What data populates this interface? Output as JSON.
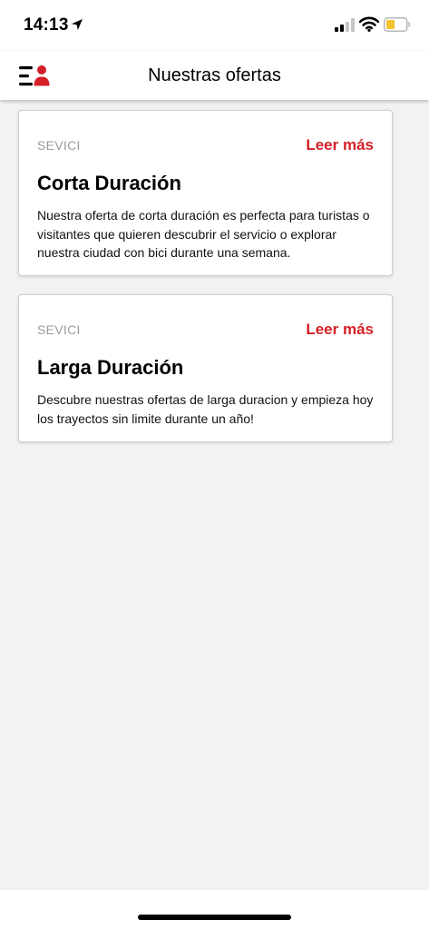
{
  "status_bar": {
    "time": "14:13",
    "icons": [
      "location-arrow-icon",
      "cellular-signal-icon",
      "wifi-icon",
      "battery-low-icon"
    ]
  },
  "header": {
    "title": "Nuestras ofertas",
    "menu_icon": "menu-profile-icon"
  },
  "offers": [
    {
      "category": "SEVICI",
      "link_label": "Leer más",
      "title": "Corta Duración",
      "description": "Nuestra oferta de corta duración es perfecta para turistas o visitantes que quieren descubrir el servicio o explorar nuestra ciudad con bici durante una semana."
    },
    {
      "category": "SEVICI",
      "link_label": "Leer más",
      "title": "Larga Duración",
      "description": "Descubre nuestras ofertas de larga duracion y empieza hoy los trayectos sin limite durante un año!"
    }
  ],
  "colors": {
    "accent": "#d41f26",
    "background": "#f2f2f2",
    "card": "#ffffff",
    "muted_text": "#9b9b9b",
    "battery_fill": "#f3c32f"
  }
}
